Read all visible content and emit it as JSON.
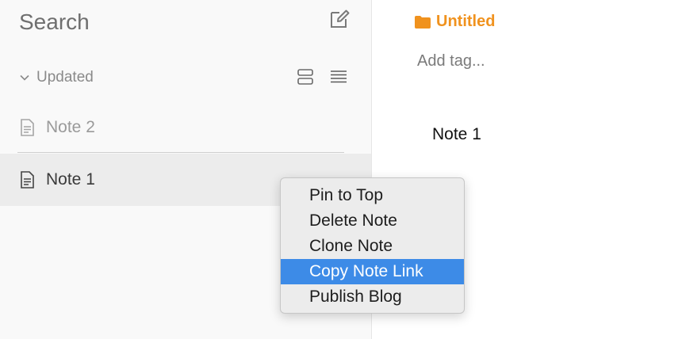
{
  "sidebar": {
    "search_label": "Search",
    "sort_label": "Updated",
    "notes": [
      {
        "title": "Note 2",
        "selected": false
      },
      {
        "title": "Note 1",
        "selected": true
      }
    ]
  },
  "editor": {
    "folder_name": "Untitled",
    "tag_placeholder": "Add tag...",
    "note_title": "Note 1"
  },
  "context_menu": {
    "items": [
      {
        "label": "Pin to Top"
      },
      {
        "label": "Delete Note"
      },
      {
        "label": "Clone Note"
      },
      {
        "label": "Copy Note Link",
        "highlighted": true
      },
      {
        "label": "Publish Blog"
      }
    ]
  },
  "colors": {
    "accent": "#f0921e",
    "highlight": "#3d8be7",
    "sidebar_bg": "#f9f9f9",
    "selected_row": "#ececec"
  },
  "icons": [
    "compose-icon",
    "chevron-down-icon",
    "card-view-icon",
    "list-view-icon",
    "note-icon",
    "folder-icon"
  ]
}
